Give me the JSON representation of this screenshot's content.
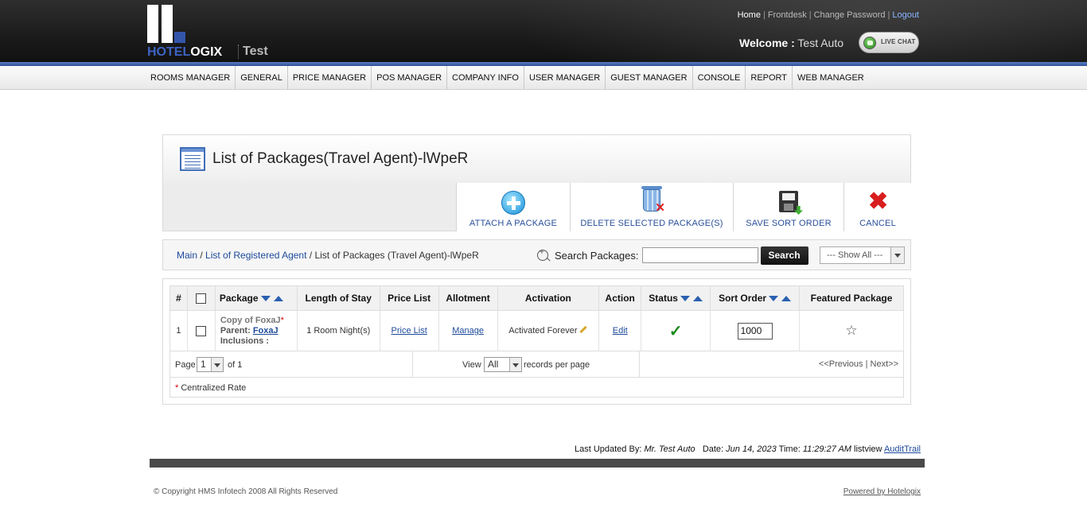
{
  "header": {
    "logo_text_blue": "HOTEL",
    "logo_text_white": "OGIX",
    "hotel_name": "Test",
    "links": {
      "home": "Home",
      "frontdesk": "Frontdesk",
      "change_password": "Change Password",
      "logout": "Logout"
    },
    "welcome_label": "Welcome :",
    "welcome_user": "Test Auto",
    "live_chat": "LIVE CHAT"
  },
  "nav": {
    "items": [
      "ROOMS MANAGER",
      "GENERAL",
      "PRICE MANAGER",
      "POS MANAGER",
      "COMPANY INFO",
      "USER MANAGER",
      "GUEST MANAGER",
      "CONSOLE",
      "REPORT",
      "WEB MANAGER"
    ]
  },
  "panel": {
    "title": "List of Packages(Travel Agent)-lWpeR",
    "toolbar": {
      "attach": "ATTACH A PACKAGE",
      "delete": "DELETE SELECTED PACKAGE(S)",
      "save_sort": "SAVE SORT ORDER",
      "cancel": "CANCEL"
    }
  },
  "breadcrumb": {
    "main": "Main",
    "agents": "List of Registered Agent",
    "current": "List of Packages (Travel Agent)-lWpeR",
    "sep": " / "
  },
  "search": {
    "label": "Search Packages:",
    "value": "",
    "button": "Search",
    "filter_selected": "--- Show All ---"
  },
  "grid": {
    "headers": {
      "num": "#",
      "package": "Package",
      "length": "Length of Stay",
      "price_list": "Price List",
      "allotment": "Allotment",
      "activation": "Activation",
      "action": "Action",
      "status": "Status",
      "sort_order": "Sort Order",
      "featured": "Featured Package"
    },
    "rows": [
      {
        "num": "1",
        "package_name": "Copy of FoxaJ",
        "star": "*",
        "parent_label": "Parent:",
        "parent_link": "FoxaJ",
        "inclusions_label": "Inclusions :",
        "length": "1 Room Night(s)",
        "price_list": "Price List",
        "allotment": "Manage",
        "activation": "Activated Forever",
        "action": "Edit",
        "status": "✓",
        "sort_order": "1000",
        "featured": "☆"
      }
    ],
    "pager": {
      "page_label": "Page",
      "page_value": "1",
      "of_label": "of 1",
      "view_label": "View",
      "view_value": "All",
      "rpp_label": "records per page",
      "prev": "<<Previous",
      "pipe": " | ",
      "next": "Next>>"
    },
    "legend_star": "*",
    "legend_text": " Centralized Rate"
  },
  "footer": {
    "last_updated_label": "Last Updated By:",
    "last_updated_user": "Mr. Test Auto",
    "date_label": "Date:",
    "date_value": "Jun 14, 2023",
    "time_label": "Time:",
    "time_value": "11:29:27 AM",
    "listview": "listview",
    "audit_trail": "AuditTrail",
    "copyright": "© Copyright HMS Infotech 2008 All Rights Reserved",
    "powered": "Powered by Hotelogix"
  },
  "colors": {
    "accent_blue": "#1d4a9a",
    "brand_blue": "#3d63c2",
    "status_green": "#1d8a1d",
    "cancel_red": "#d81e1e"
  }
}
